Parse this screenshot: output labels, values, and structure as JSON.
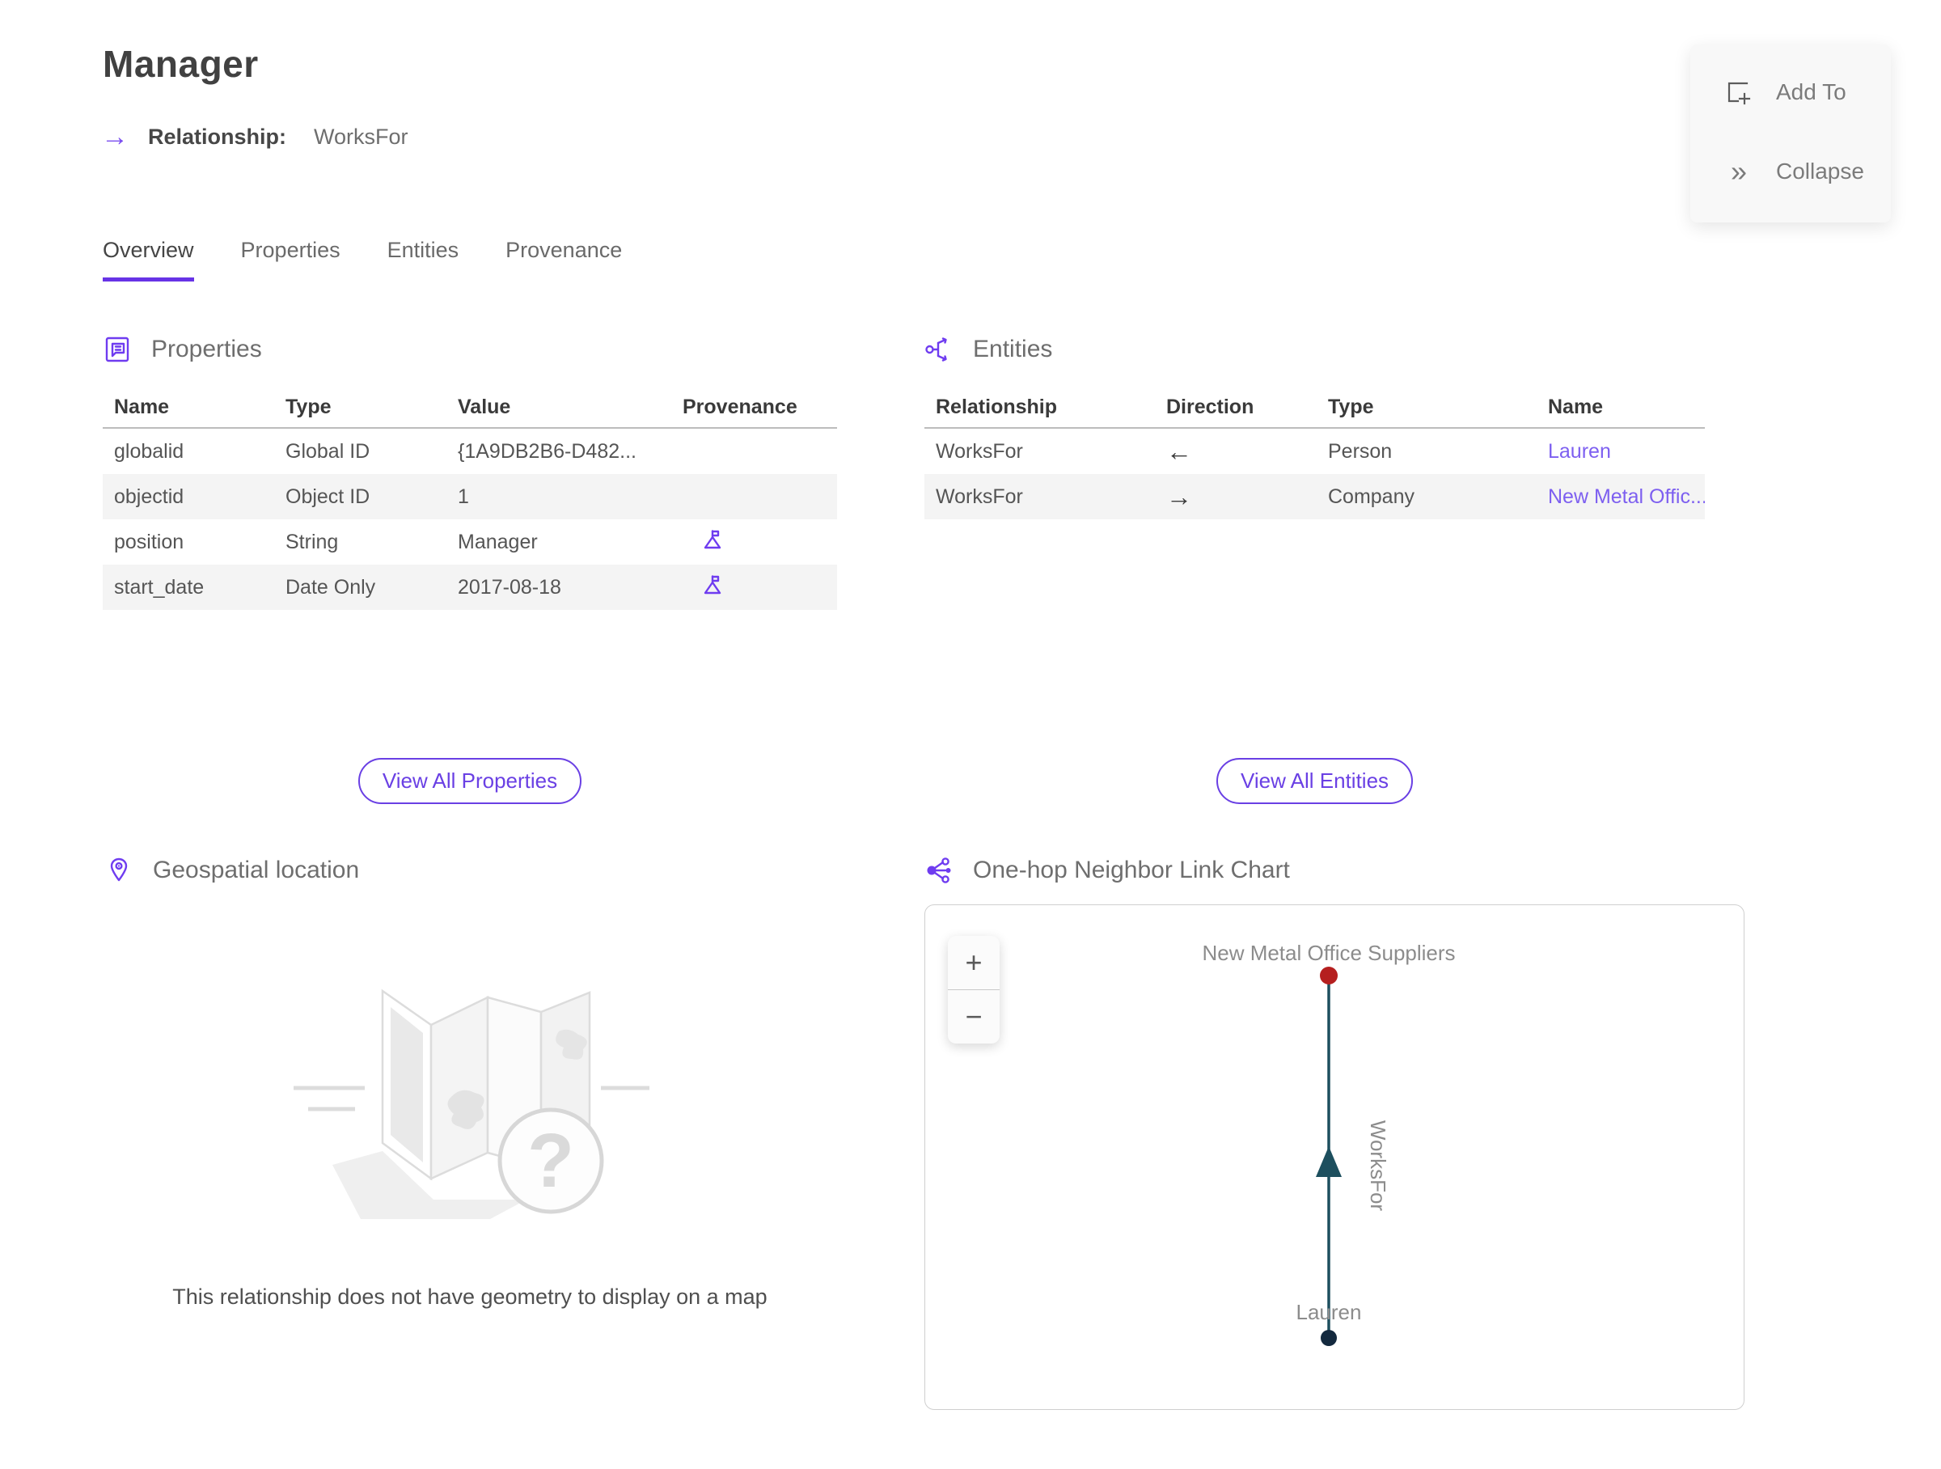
{
  "header": {
    "title": "Manager",
    "subtitle_label": "Relationship:",
    "subtitle_value": "WorksFor"
  },
  "actions": {
    "add_to_label": "Add To",
    "collapse_label": "Collapse"
  },
  "tabs": [
    {
      "label": "Overview"
    },
    {
      "label": "Properties"
    },
    {
      "label": "Entities"
    },
    {
      "label": "Provenance"
    }
  ],
  "properties_section": {
    "title": "Properties",
    "columns": [
      "Name",
      "Type",
      "Value",
      "Provenance"
    ],
    "rows": [
      {
        "name": "globalid",
        "type": "Global ID",
        "value": "{1A9DB2B6-D482...",
        "has_provenance": false
      },
      {
        "name": "objectid",
        "type": "Object ID",
        "value": "1",
        "has_provenance": false
      },
      {
        "name": "position",
        "type": "String",
        "value": "Manager",
        "has_provenance": true
      },
      {
        "name": "start_date",
        "type": "Date Only",
        "value": "2017-08-18",
        "has_provenance": true
      }
    ],
    "view_all_label": "View All Properties"
  },
  "entities_section": {
    "title": "Entities",
    "columns": [
      "Relationship",
      "Direction",
      "Type",
      "Name"
    ],
    "rows": [
      {
        "relationship": "WorksFor",
        "direction": "←",
        "type": "Person",
        "name": "Lauren"
      },
      {
        "relationship": "WorksFor",
        "direction": "→",
        "type": "Company",
        "name": "New Metal Offic..."
      }
    ],
    "view_all_label": "View All Entities"
  },
  "geospatial_section": {
    "title": "Geospatial location",
    "empty_message": "This relationship does not have geometry to display on a map"
  },
  "link_chart_section": {
    "title": "One-hop Neighbor Link Chart",
    "top_node_label": "New Metal Office Suppliers",
    "edge_label": "WorksFor",
    "bottom_node_label": "Lauren"
  },
  "icons": {
    "relationship_arrow": "→",
    "collapse_chevrons": "»",
    "zoom_in": "+",
    "zoom_out": "−"
  },
  "colors": {
    "accent_purple": "#6b3fe8",
    "link_purple": "#7d5ff0",
    "tab_underline": "#6733e6",
    "edge_teal": "#1d4f5e",
    "company_node_red": "#b51f1f",
    "person_node_navy": "#13293e"
  }
}
